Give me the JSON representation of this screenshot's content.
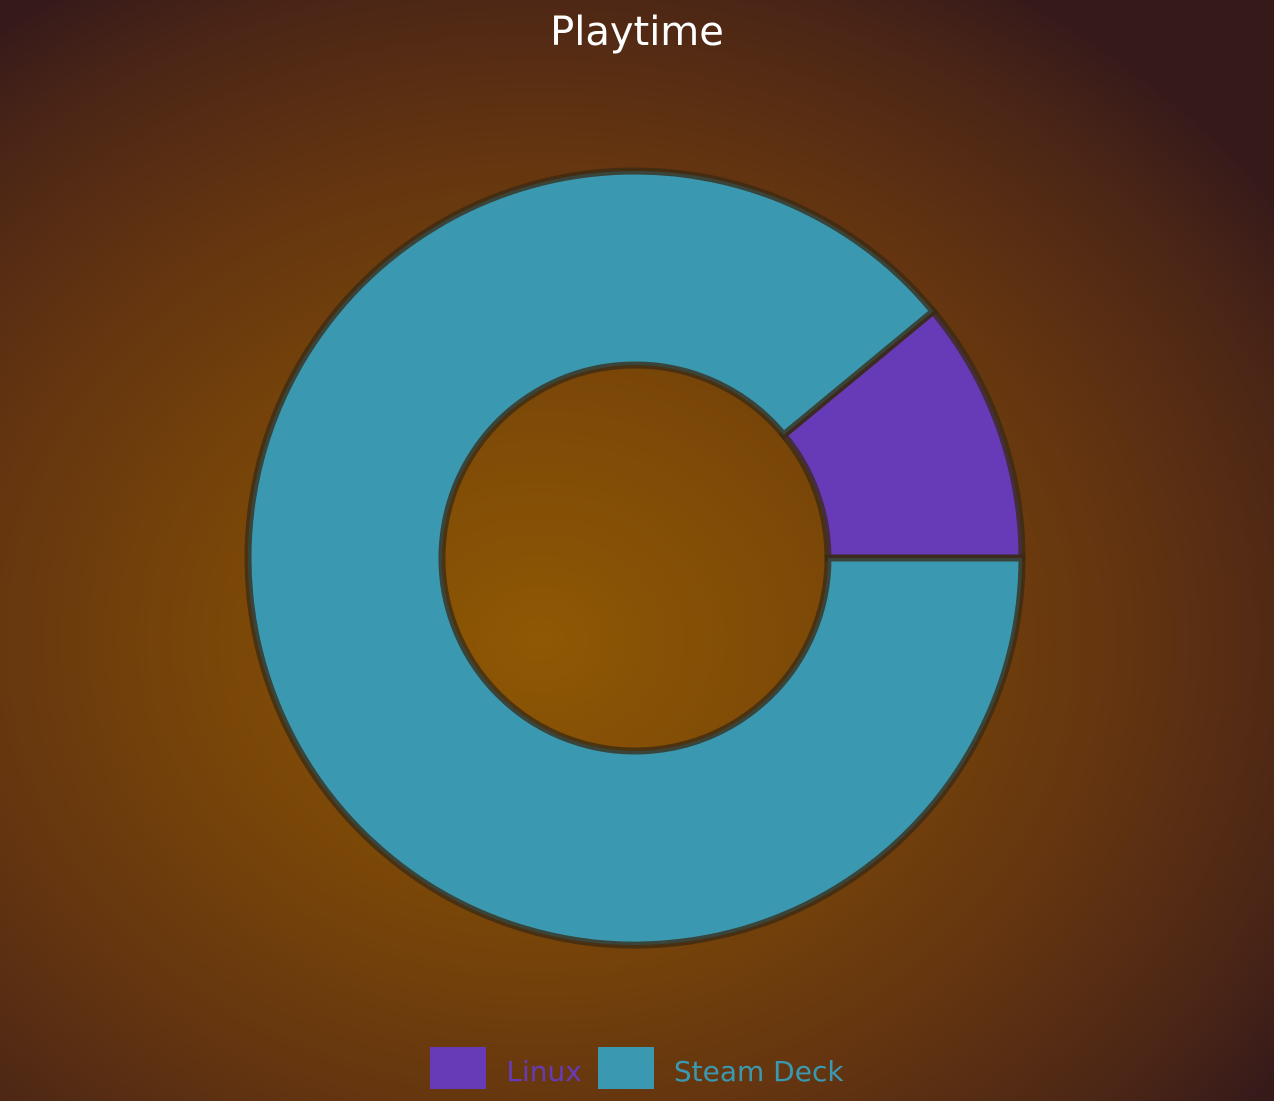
{
  "chart_data": {
    "type": "pie",
    "variant": "donut",
    "title": "Playtime",
    "series": [
      {
        "name": "Linux",
        "value": 11,
        "color": "#673ab7"
      },
      {
        "name": "Steam Deck",
        "value": 89,
        "color": "#3a99b0"
      }
    ],
    "legend": "bottom",
    "start_angle_deg": 0,
    "direction": "counterclockwise"
  },
  "colors": {
    "background_center": "#8f5804",
    "background_edge": "#361a1a",
    "slice_outline": "#3a2a14",
    "title": "#ffffff"
  }
}
